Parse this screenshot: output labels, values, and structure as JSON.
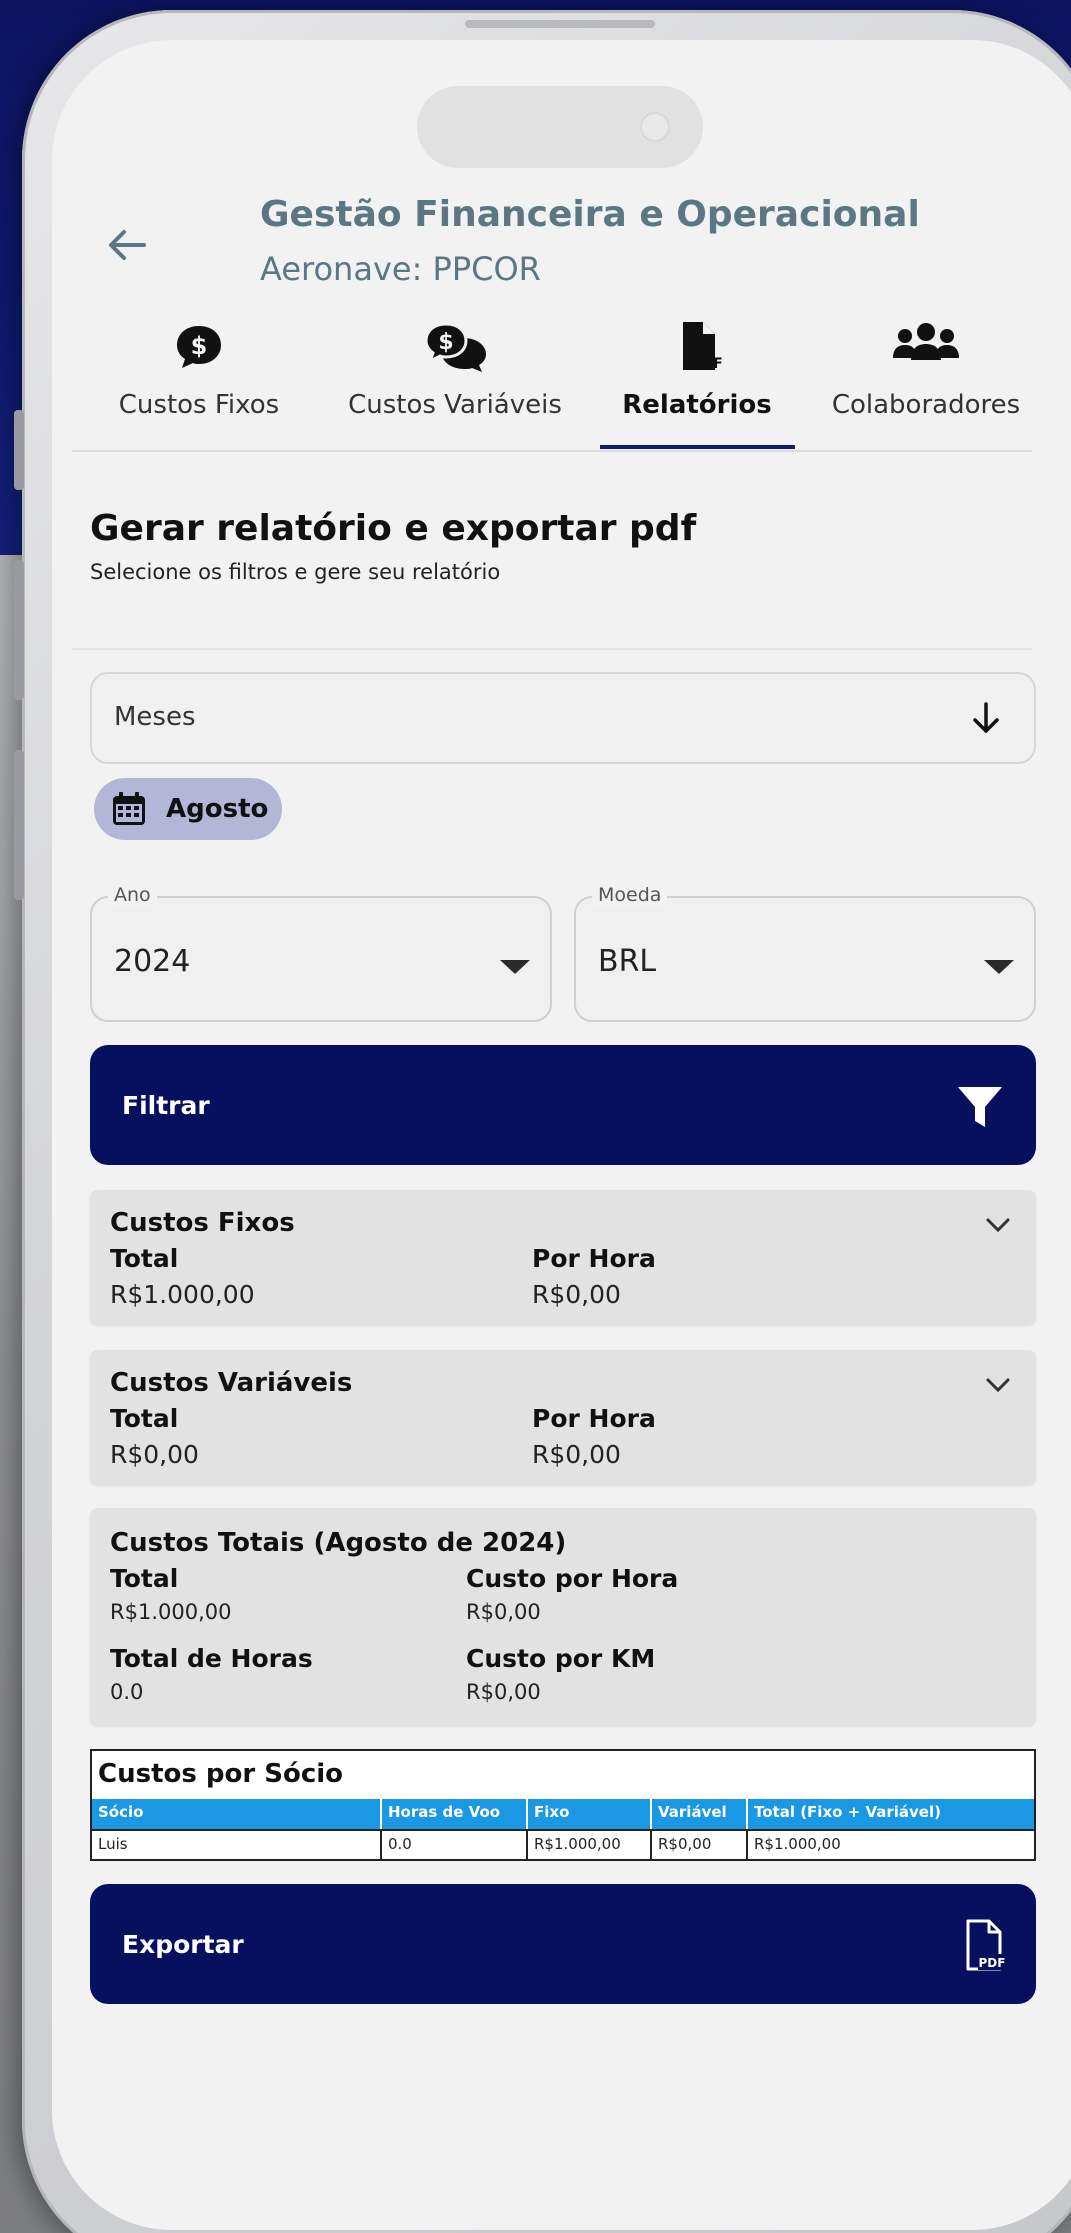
{
  "header": {
    "title": "Gestão Financeira e Operacional",
    "subtitle": "Aeronave: PPCOR"
  },
  "tabs": [
    {
      "label": "Custos Fixos",
      "icon": "dollar-bubble-icon",
      "active": false
    },
    {
      "label": "Custos Variáveis",
      "icon": "dollar-chat-icon",
      "active": false
    },
    {
      "label": "Relatórios",
      "icon": "pdf-file-icon",
      "active": true
    },
    {
      "label": "Colaboradores",
      "icon": "people-group-icon",
      "active": false
    }
  ],
  "report": {
    "title": "Gerar relatório e exportar pdf",
    "subtitle": "Selecione os filtros e gere seu relatório"
  },
  "months_select": {
    "label": "Meses"
  },
  "selected_chip": {
    "label": "Agosto"
  },
  "year_field": {
    "legend": "Ano",
    "value": "2024"
  },
  "currency_field": {
    "legend": "Moeda",
    "value": "BRL"
  },
  "filter_button": {
    "label": "Filtrar"
  },
  "fixed_costs": {
    "title": "Custos Fixos",
    "total_label": "Total",
    "total_value": "R$1.000,00",
    "per_hour_label": "Por Hora",
    "per_hour_value": "R$0,00"
  },
  "variable_costs": {
    "title": "Custos Variáveis",
    "total_label": "Total",
    "total_value": "R$0,00",
    "per_hour_label": "Por Hora",
    "per_hour_value": "R$0,00"
  },
  "total_costs": {
    "title": "Custos Totais (Agosto de 2024)",
    "total_label": "Total",
    "total_value": "R$1.000,00",
    "cost_hour_label": "Custo por Hora",
    "cost_hour_value": "R$0,00",
    "hours_label": "Total de Horas",
    "hours_value": "0.0",
    "cost_km_label": "Custo por KM",
    "cost_km_value": "R$0,00"
  },
  "partners_table": {
    "title": "Custos por Sócio",
    "columns": [
      "Sócio",
      "Horas de Voo",
      "Fixo",
      "Variável",
      "Total (Fixo + Variável)"
    ],
    "rows": [
      [
        "Luis",
        "0.0",
        "R$1.000,00",
        "R$0,00",
        "R$1.000,00"
      ]
    ]
  },
  "export_button": {
    "label": "Exportar"
  },
  "colors": {
    "primary": "#07105f",
    "title_text": "#5b7784",
    "chip_bg": "#b3b6d6",
    "table_header": "#1a98e4"
  }
}
